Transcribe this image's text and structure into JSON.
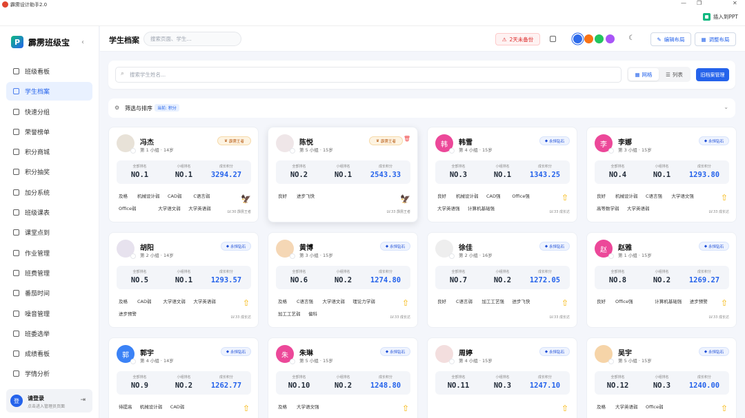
{
  "app": {
    "title": "霹雳设计助手2.0",
    "window_controls": [
      "—",
      "❐",
      "✕"
    ],
    "insert_ppt": "插入到PPT"
  },
  "sidebar": {
    "logo_mark": "P",
    "name": "霹雳班级宝",
    "collapse": "‹",
    "items": [
      {
        "label": "班级看板"
      },
      {
        "label": "学生档案",
        "active": true
      },
      {
        "label": "快速分组"
      },
      {
        "label": "荣誉榜单"
      },
      {
        "label": "积分商城"
      },
      {
        "label": "积分抽奖"
      },
      {
        "label": "加分系统"
      },
      {
        "label": "班级课表"
      },
      {
        "label": "课堂点到"
      },
      {
        "label": "作业管理"
      },
      {
        "label": "班费管理"
      },
      {
        "label": "番茄时间"
      },
      {
        "label": "噪音管理"
      },
      {
        "label": "班委选举"
      },
      {
        "label": "成绩看板"
      },
      {
        "label": "学情分析"
      }
    ],
    "login": {
      "avatar": "登",
      "title": "请登录",
      "subtitle": "点击进入管理员页面",
      "logout_icon": "⇥"
    }
  },
  "header": {
    "title": "学生档案",
    "search_placeholder": "搜索页面、学生...",
    "warning": "2天未备份",
    "edit_layout": "编辑布局",
    "adjust_layout": "调整布局",
    "moon": "☾",
    "theme_colors": [
      "#2f6bea",
      "#f97316",
      "#22c55e",
      "#a855f7"
    ]
  },
  "toolbar": {
    "search_placeholder": "搜索学生姓名...",
    "grid": "网格",
    "list": "列表",
    "archive": "旧档案管理"
  },
  "filter": {
    "label": "筛选与排序",
    "tag": "当前: 积分",
    "icon": "⚙",
    "chevron": "⌄"
  },
  "stat_labels": [
    "全部排名",
    "小组排名",
    "成长积分"
  ],
  "students": [
    {
      "name": "冯杰",
      "info": "第 1 小组 · 14岁",
      "badge": "霹雳王者",
      "badge_type": "king",
      "avatar_color": "#e8e2d8",
      "avatar_text": "",
      "rank_all": "NO.1",
      "rank_group": "NO.1",
      "score": "3294.27",
      "tags": [
        "及格",
        "机械设计弱",
        "CAD弱",
        "C语言弱",
        "Office弱",
        "大学语文弱",
        "大学英语弱"
      ],
      "lv": "LV.30 霹雳王者",
      "lv_icon": "🦅"
    },
    {
      "name": "陈悦",
      "info": "第 5 小组 · 15岁",
      "badge": "霹雳王者",
      "badge_type": "king",
      "avatar_color": "#efe6e8",
      "avatar_text": "",
      "rank_all": "NO.2",
      "rank_group": "NO.1",
      "score": "2543.33",
      "tags": [
        "良好",
        "进步飞快"
      ],
      "lv": "LV.33 霹雳王者",
      "lv_icon": "🦅",
      "delete": "🗑"
    },
    {
      "name": "韩雪",
      "info": "第 4 小组 · 15岁",
      "badge": "永恒钻石",
      "badge_type": "dia",
      "avatar_color": "#ec4899",
      "avatar_text": "韩",
      "rank_all": "NO.3",
      "rank_group": "NO.1",
      "score": "1343.25",
      "tags": [
        "良好",
        "机械设计弱",
        "CAD强",
        "Office强",
        "大学英语强",
        "计算机基础强"
      ],
      "lv": "LV.33 成长达",
      "lv_icon": "⇧"
    },
    {
      "name": "李娜",
      "info": "第 3 小组 · 15岁",
      "badge": "永恒钻石",
      "badge_type": "dia",
      "avatar_color": "#ec4899",
      "avatar_text": "李",
      "rank_all": "NO.4",
      "rank_group": "NO.1",
      "score": "1293.80",
      "tags": [
        "良好",
        "机械设计弱",
        "C语言强",
        "大学语文强",
        "高等数学弱",
        "大学英语弱"
      ],
      "lv": "LV.33 成长达",
      "lv_icon": "⇧"
    },
    {
      "name": "胡阳",
      "info": "第 2 小组 · 14岁",
      "badge": "永恒钻石",
      "badge_type": "dia",
      "avatar_color": "#e7e2ee",
      "avatar_text": "",
      "rank_all": "NO.5",
      "rank_group": "NO.1",
      "score": "1293.57",
      "tags": [
        "及格",
        "CAD弱",
        "大学语文弱",
        "大学英语弱",
        "进步预警"
      ],
      "lv": "LV.33 成长达",
      "lv_icon": "⇧"
    },
    {
      "name": "黄博",
      "info": "第 3 小组 · 15岁",
      "badge": "永恒钻石",
      "badge_type": "dia",
      "avatar_color": "#f5d7b5",
      "avatar_text": "",
      "rank_all": "NO.6",
      "rank_group": "NO.2",
      "score": "1274.80",
      "tags": [
        "及格",
        "C语言强",
        "大学语文弱",
        "理论力学弱",
        "加工工艺弱",
        "偏科"
      ],
      "lv": "LV.33 成长达",
      "lv_icon": "⇧"
    },
    {
      "name": "徐佳",
      "info": "第 2 小组 · 16岁",
      "badge": "永恒钻石",
      "badge_type": "dia",
      "avatar_color": "#eeeeee",
      "avatar_text": "",
      "rank_all": "NO.7",
      "rank_group": "NO.2",
      "score": "1272.05",
      "tags": [
        "良好",
        "C语言弱",
        "加工工艺强",
        "进步飞快"
      ],
      "lv": "LV.33 成长达",
      "lv_icon": "⇧"
    },
    {
      "name": "赵雅",
      "info": "第 1 小组 · 15岁",
      "badge": "永恒钻石",
      "badge_type": "dia",
      "avatar_color": "#ec4899",
      "avatar_text": "赵",
      "rank_all": "NO.8",
      "rank_group": "NO.2",
      "score": "1269.27",
      "tags": [
        "良好",
        "Office强",
        "计算机基础强",
        "进步预警"
      ],
      "lv": "LV.33 成长达",
      "lv_icon": "⇧"
    },
    {
      "name": "郭宇",
      "info": "第 4 小组 · 14岁",
      "badge": "永恒钻石",
      "badge_type": "dia",
      "avatar_color": "#3b82f6",
      "avatar_text": "郭",
      "rank_all": "NO.9",
      "rank_group": "NO.2",
      "score": "1262.77",
      "tags": [
        "待提高",
        "机械设计弱",
        "CAD弱"
      ],
      "lv": "",
      "lv_icon": "⇧"
    },
    {
      "name": "朱琳",
      "info": "第 5 小组 · 15岁",
      "badge": "永恒钻石",
      "badge_type": "dia",
      "avatar_color": "#ec4899",
      "avatar_text": "朱",
      "rank_all": "NO.10",
      "rank_group": "NO.2",
      "score": "1248.80",
      "tags": [
        "及格",
        "大学语文强"
      ],
      "lv": "",
      "lv_icon": "⇧"
    },
    {
      "name": "周婷",
      "info": "第 4 小组 · 15岁",
      "badge": "永恒钻石",
      "badge_type": "dia",
      "avatar_color": "#f3dede",
      "avatar_text": "",
      "rank_all": "NO.11",
      "rank_group": "NO.3",
      "score": "1247.10",
      "tags": [],
      "lv": "",
      "lv_icon": "⇧"
    },
    {
      "name": "吴宇",
      "info": "第 5 小组 · 15岁",
      "badge": "永恒钻石",
      "badge_type": "dia",
      "avatar_color": "#f6d4a8",
      "avatar_text": "",
      "rank_all": "NO.12",
      "rank_group": "NO.3",
      "score": "1240.00",
      "tags": [
        "及格",
        "大学英语弱",
        "Office弱"
      ],
      "lv": "",
      "lv_icon": "⇧"
    }
  ]
}
